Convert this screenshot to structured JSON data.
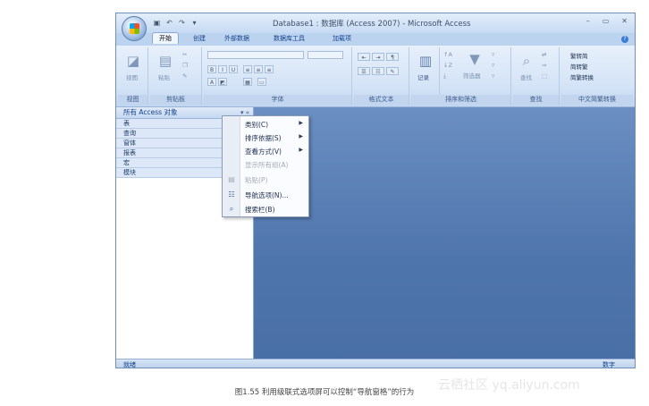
{
  "window": {
    "title": "Database1 : 数据库 (Access 2007) - Microsoft Access",
    "controls": [
      "–",
      "▭",
      "✕"
    ]
  },
  "qat": {
    "icons": [
      "save-icon",
      "undo-icon",
      "redo-icon",
      "customize-icon"
    ]
  },
  "tabs": [
    "开始",
    "创建",
    "外部数据",
    "数据库工具",
    "加载项"
  ],
  "ribbon": {
    "groups": [
      "视图",
      "剪贴板",
      "字体",
      "格式文本",
      "记录",
      "排序和筛选",
      "查找",
      "中文简繁转换"
    ],
    "view_button": "视图",
    "paste_button": "粘贴",
    "records_button": "记录",
    "filter_button": "筛选器",
    "find_button": "查找",
    "convert": [
      "繁转简",
      "简转繁",
      "简繁转换"
    ]
  },
  "nav": {
    "header": "所有 Access 对象",
    "items": [
      "表",
      "查询",
      "窗体",
      "报表",
      "宏",
      "模块"
    ]
  },
  "context_menu": {
    "items": [
      {
        "label": "类别(C)",
        "submenu": true,
        "disabled": false,
        "icon": ""
      },
      {
        "label": "排序依据(S)",
        "submenu": true,
        "disabled": false,
        "icon": ""
      },
      {
        "label": "查看方式(V)",
        "submenu": true,
        "disabled": false,
        "icon": ""
      },
      {
        "label": "显示所有组(A)",
        "submenu": false,
        "disabled": true,
        "icon": ""
      },
      {
        "label": "粘贴(P)",
        "submenu": false,
        "disabled": true,
        "icon": "paste-icon"
      },
      {
        "label": "导航选项(N)...",
        "submenu": false,
        "disabled": false,
        "icon": "nav-options-icon"
      },
      {
        "label": "搜索栏(B)",
        "submenu": false,
        "disabled": false,
        "icon": "search-icon"
      }
    ]
  },
  "status": {
    "left": "就绪",
    "right": "数字"
  },
  "caption": "图1.55   利用级联式选项屏可以控制“导航窗格”的行为",
  "watermark": "云栖社区 yq.aliyun.com"
}
